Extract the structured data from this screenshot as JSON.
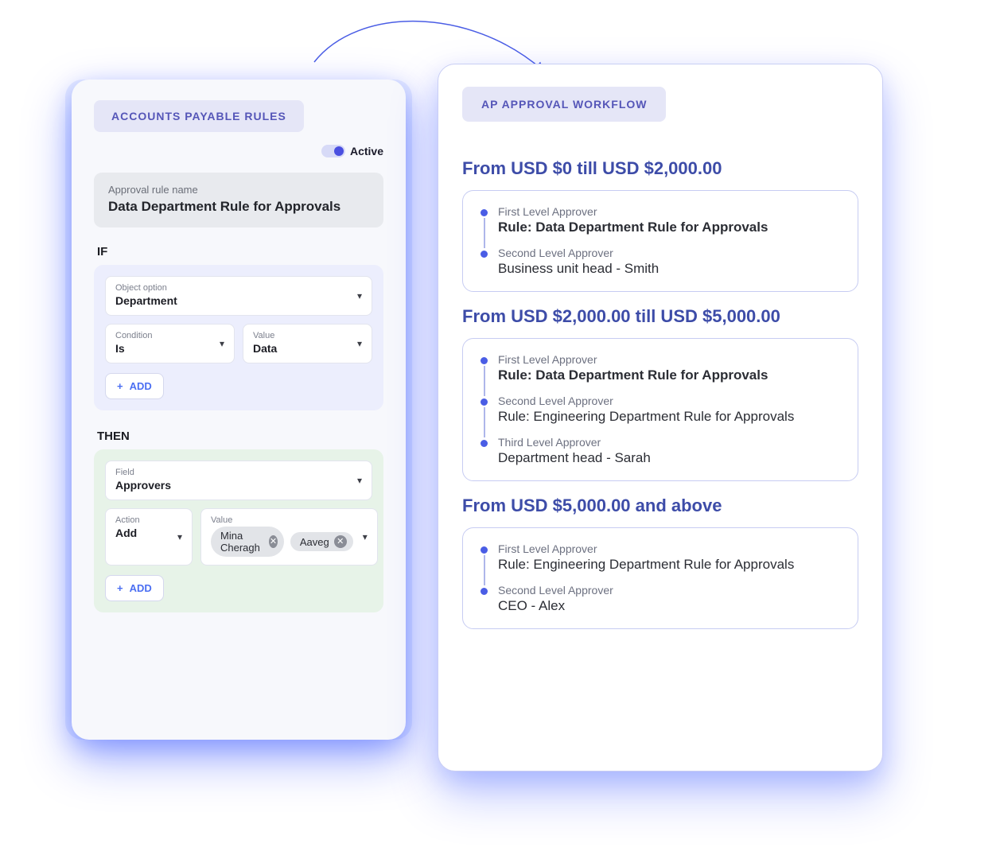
{
  "rules_panel": {
    "title": "ACCOUNTS PAYABLE RULES",
    "active_label": "Active",
    "rule_name_label": "Approval rule name",
    "rule_name_value": "Data Department Rule for Approvals",
    "if_label": "IF",
    "then_label": "THEN",
    "if": {
      "object_option_label": "Object option",
      "object_option_value": "Department",
      "condition_label": "Condition",
      "condition_value": "Is",
      "value_label": "Value",
      "value_value": "Data",
      "add_label": "ADD"
    },
    "then": {
      "field_label": "Field",
      "field_value": "Approvers",
      "action_label": "Action",
      "action_value": "Add",
      "value_label": "Value",
      "chips": [
        "Mina Cheragh",
        "Aaveg"
      ],
      "add_label": "ADD"
    }
  },
  "workflow_panel": {
    "title": "AP APPROVAL WORKFLOW",
    "tiers": [
      {
        "title": "From USD $0 till USD $2,000.00",
        "steps": [
          {
            "label": "First Level Approver",
            "value": "Rule: Data Department Rule for Approvals",
            "bold": true
          },
          {
            "label": "Second Level Approver",
            "value": "Business unit head - Smith",
            "bold": false
          }
        ]
      },
      {
        "title": "From USD $2,000.00 till USD $5,000.00",
        "steps": [
          {
            "label": "First Level Approver",
            "value": "Rule: Data Department Rule for Approvals",
            "bold": true
          },
          {
            "label": "Second Level Approver",
            "value": "Rule: Engineering Department Rule for Approvals",
            "bold": false
          },
          {
            "label": "Third Level Approver",
            "value": "Department head - Sarah",
            "bold": false
          }
        ]
      },
      {
        "title": "From USD $5,000.00 and above",
        "steps": [
          {
            "label": "First Level Approver",
            "value": "Rule: Engineering Department Rule for Approvals",
            "bold": false
          },
          {
            "label": "Second Level Approver",
            "value": "CEO - Alex",
            "bold": false
          }
        ]
      }
    ]
  }
}
